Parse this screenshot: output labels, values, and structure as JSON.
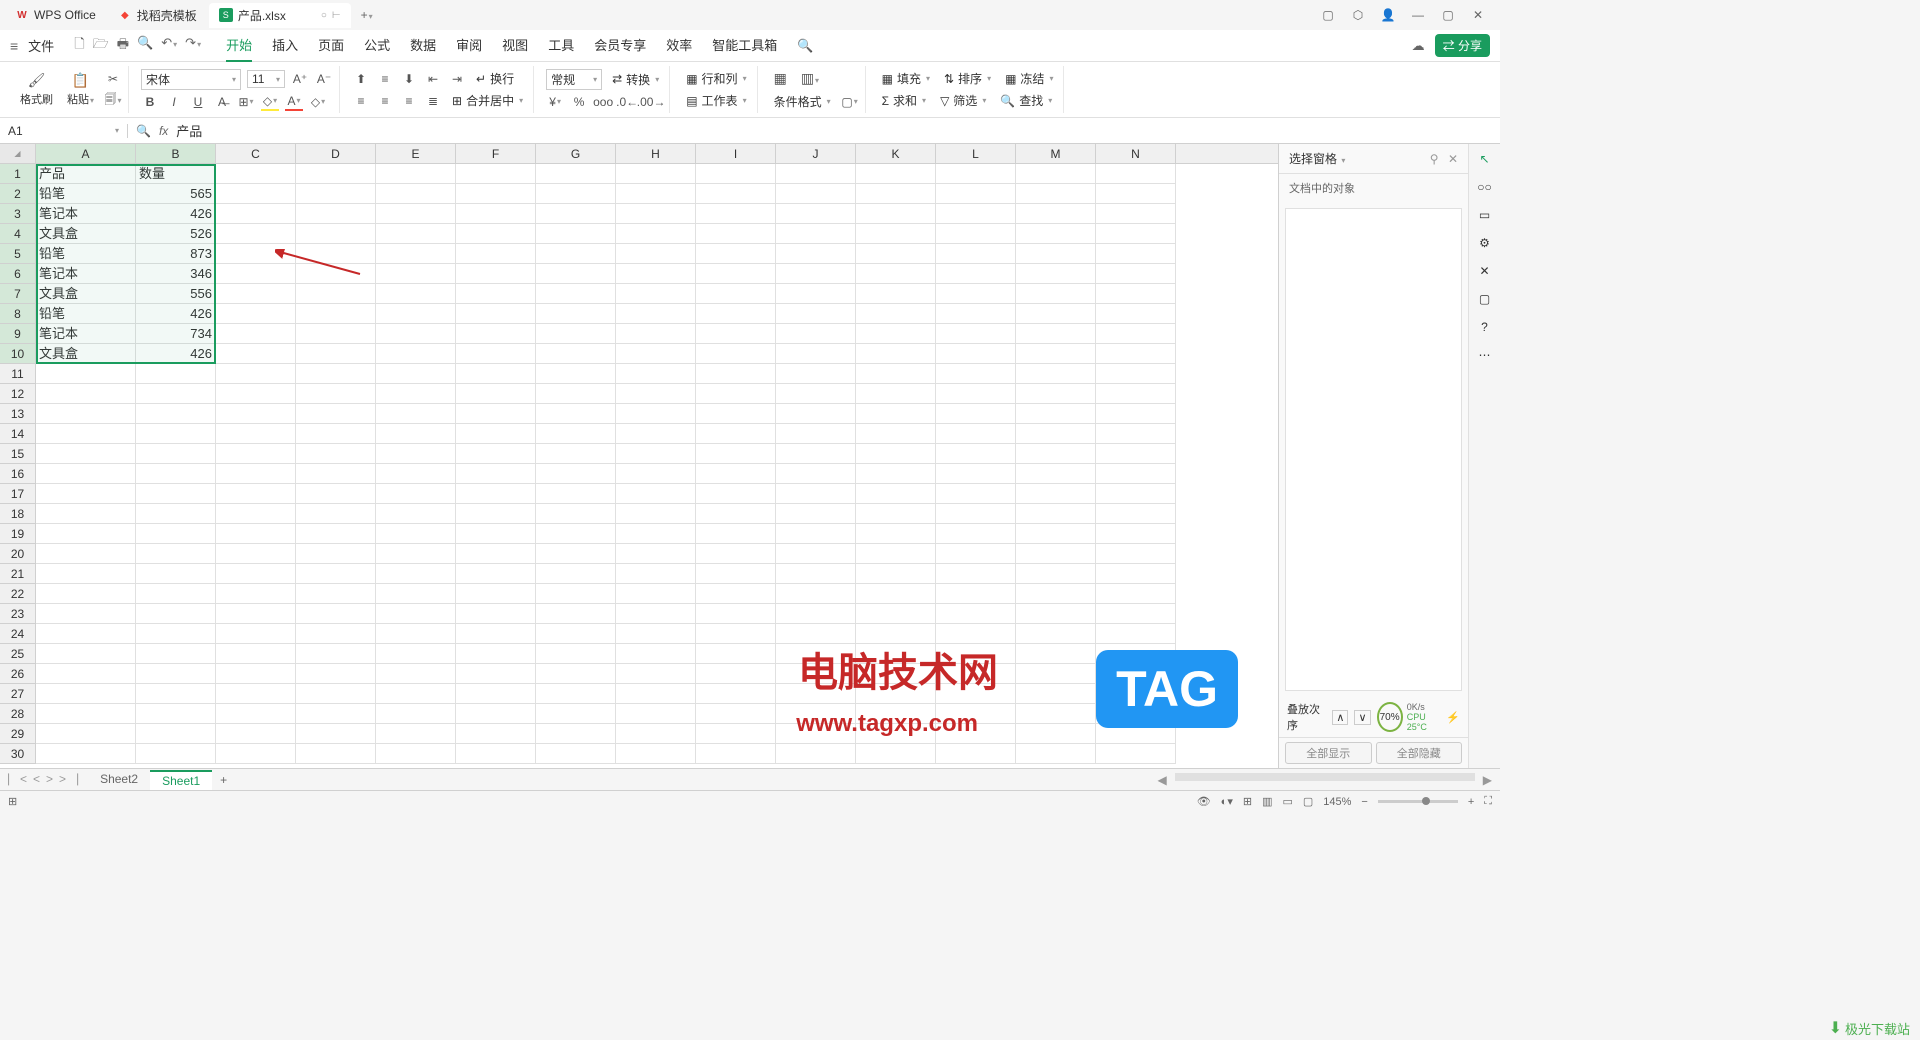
{
  "titlebar": {
    "tabs": [
      {
        "icon": "W",
        "iconColor": "#d32f2f",
        "label": "WPS Office"
      },
      {
        "icon": "●",
        "iconColor": "#f44336",
        "label": "找稻壳模板"
      },
      {
        "icon": "S",
        "iconColor": "#1a9c5e",
        "label": "产品.xlsx",
        "active": true
      }
    ]
  },
  "menubar": {
    "file": "文件",
    "tabs": [
      "开始",
      "插入",
      "页面",
      "公式",
      "数据",
      "审阅",
      "视图",
      "工具",
      "会员专享",
      "效率",
      "智能工具箱"
    ],
    "activeTab": "开始",
    "share": "分享"
  },
  "ribbon": {
    "formatBrush": "格式刷",
    "paste": "粘贴",
    "fontName": "宋体",
    "fontSize": "11",
    "numberFormat": "常规",
    "wrap": "换行",
    "convert": "转换",
    "rowCol": "行和列",
    "worksheet": "工作表",
    "mergeCenter": "合并居中",
    "condFormat": "条件格式",
    "sum": "求和",
    "fill": "填充",
    "sort": "排序",
    "freeze": "冻结",
    "filter": "筛选",
    "find": "查找"
  },
  "formulaBar": {
    "nameBox": "A1",
    "formula": "产品"
  },
  "columns": [
    "A",
    "B",
    "C",
    "D",
    "E",
    "F",
    "G",
    "H",
    "I",
    "J",
    "K",
    "L",
    "M",
    "N"
  ],
  "rowCount": 30,
  "data": {
    "headers": [
      "产品",
      "数量"
    ],
    "rows": [
      [
        "铅笔",
        565
      ],
      [
        "笔记本",
        426
      ],
      [
        "文具盒",
        526
      ],
      [
        "铅笔",
        873
      ],
      [
        "笔记本",
        346
      ],
      [
        "文具盒",
        556
      ],
      [
        "铅笔",
        426
      ],
      [
        "笔记本",
        734
      ],
      [
        "文具盒",
        426
      ]
    ]
  },
  "sidePanel": {
    "title": "选择窗格",
    "subtitle": "文档中的对象",
    "stackOrder": "叠放次序",
    "showAll": "全部显示",
    "hideAll": "全部隐藏"
  },
  "sheets": {
    "tabs": [
      "Sheet2",
      "Sheet1"
    ],
    "active": "Sheet1"
  },
  "statusBar": {
    "zoom": "145%",
    "perf": "70%",
    "netSpeed": "0K/s",
    "cpu": "CPU 25°C"
  },
  "watermarks": {
    "text1": "电脑技术网",
    "text1b": "www.tagxp.com",
    "text2": "TAG",
    "text3": "极光下载站"
  }
}
